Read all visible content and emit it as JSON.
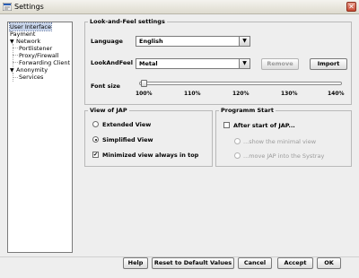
{
  "window": {
    "title": "Settings",
    "close_glyph": "✕"
  },
  "tree": {
    "items": [
      {
        "label": "User Interface",
        "selected": true
      },
      {
        "label": "Payment"
      },
      {
        "label": "Network",
        "expanded": true
      },
      {
        "label": "Portlistener"
      },
      {
        "label": "Proxy/Firewall"
      },
      {
        "label": "Forwarding Client"
      },
      {
        "label": "Anonymity",
        "expanded": true
      },
      {
        "label": "Services"
      }
    ],
    "expand_glyph": "▼"
  },
  "laf": {
    "title": "Look-and-Feel settings",
    "language_label": "Language",
    "language_value": "English",
    "lookandfeel_label": "LookAndFeel",
    "lookandfeel_value": "Metal",
    "remove_label": "Remove",
    "import_label": "Import",
    "fontsize_label": "Font size",
    "fontsize_ticks": [
      "100%",
      "110%",
      "120%",
      "130%",
      "140%"
    ],
    "fontsize_value": "100%",
    "dropdown_glyph": "▼"
  },
  "view": {
    "title": "View of JAP",
    "extended_label": "Extended View",
    "simplified_label": "Simplified View",
    "minimized_label": "Minimized view always in top",
    "check_glyph": "✔"
  },
  "programm": {
    "title": "Programm Start",
    "after_start_label": "After start of JAP...",
    "minimal_label": "...show the minimal view",
    "systray_label": "...move JAP into the Systray"
  },
  "buttons": {
    "help": "Help",
    "reset": "Reset to Default Values",
    "cancel": "Cancel",
    "accept": "Accept",
    "ok": "OK"
  }
}
